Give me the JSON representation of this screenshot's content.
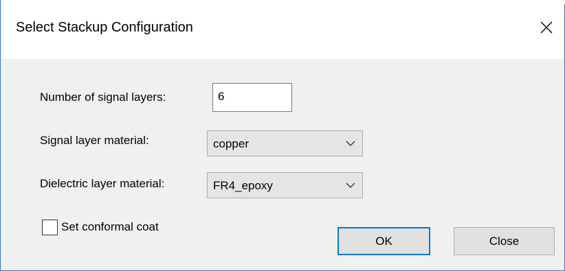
{
  "dialog": {
    "title": "Select Stackup Configuration",
    "close_icon": "close-icon"
  },
  "form": {
    "signal_layers_label": "Number of signal layers:",
    "signal_layers_value": "6",
    "signal_material_label": "Signal layer material:",
    "signal_material_value": "copper",
    "dielectric_material_label": "Dielectric layer material:",
    "dielectric_material_value": "FR4_epoxy",
    "conformal_coat_label": "Set conformal coat",
    "conformal_coat_checked": false
  },
  "buttons": {
    "ok_label": "OK",
    "close_label": "Close"
  },
  "colors": {
    "accent": "#0078d7",
    "window_border": "#2b79d7",
    "background": "#f0f0f0"
  }
}
